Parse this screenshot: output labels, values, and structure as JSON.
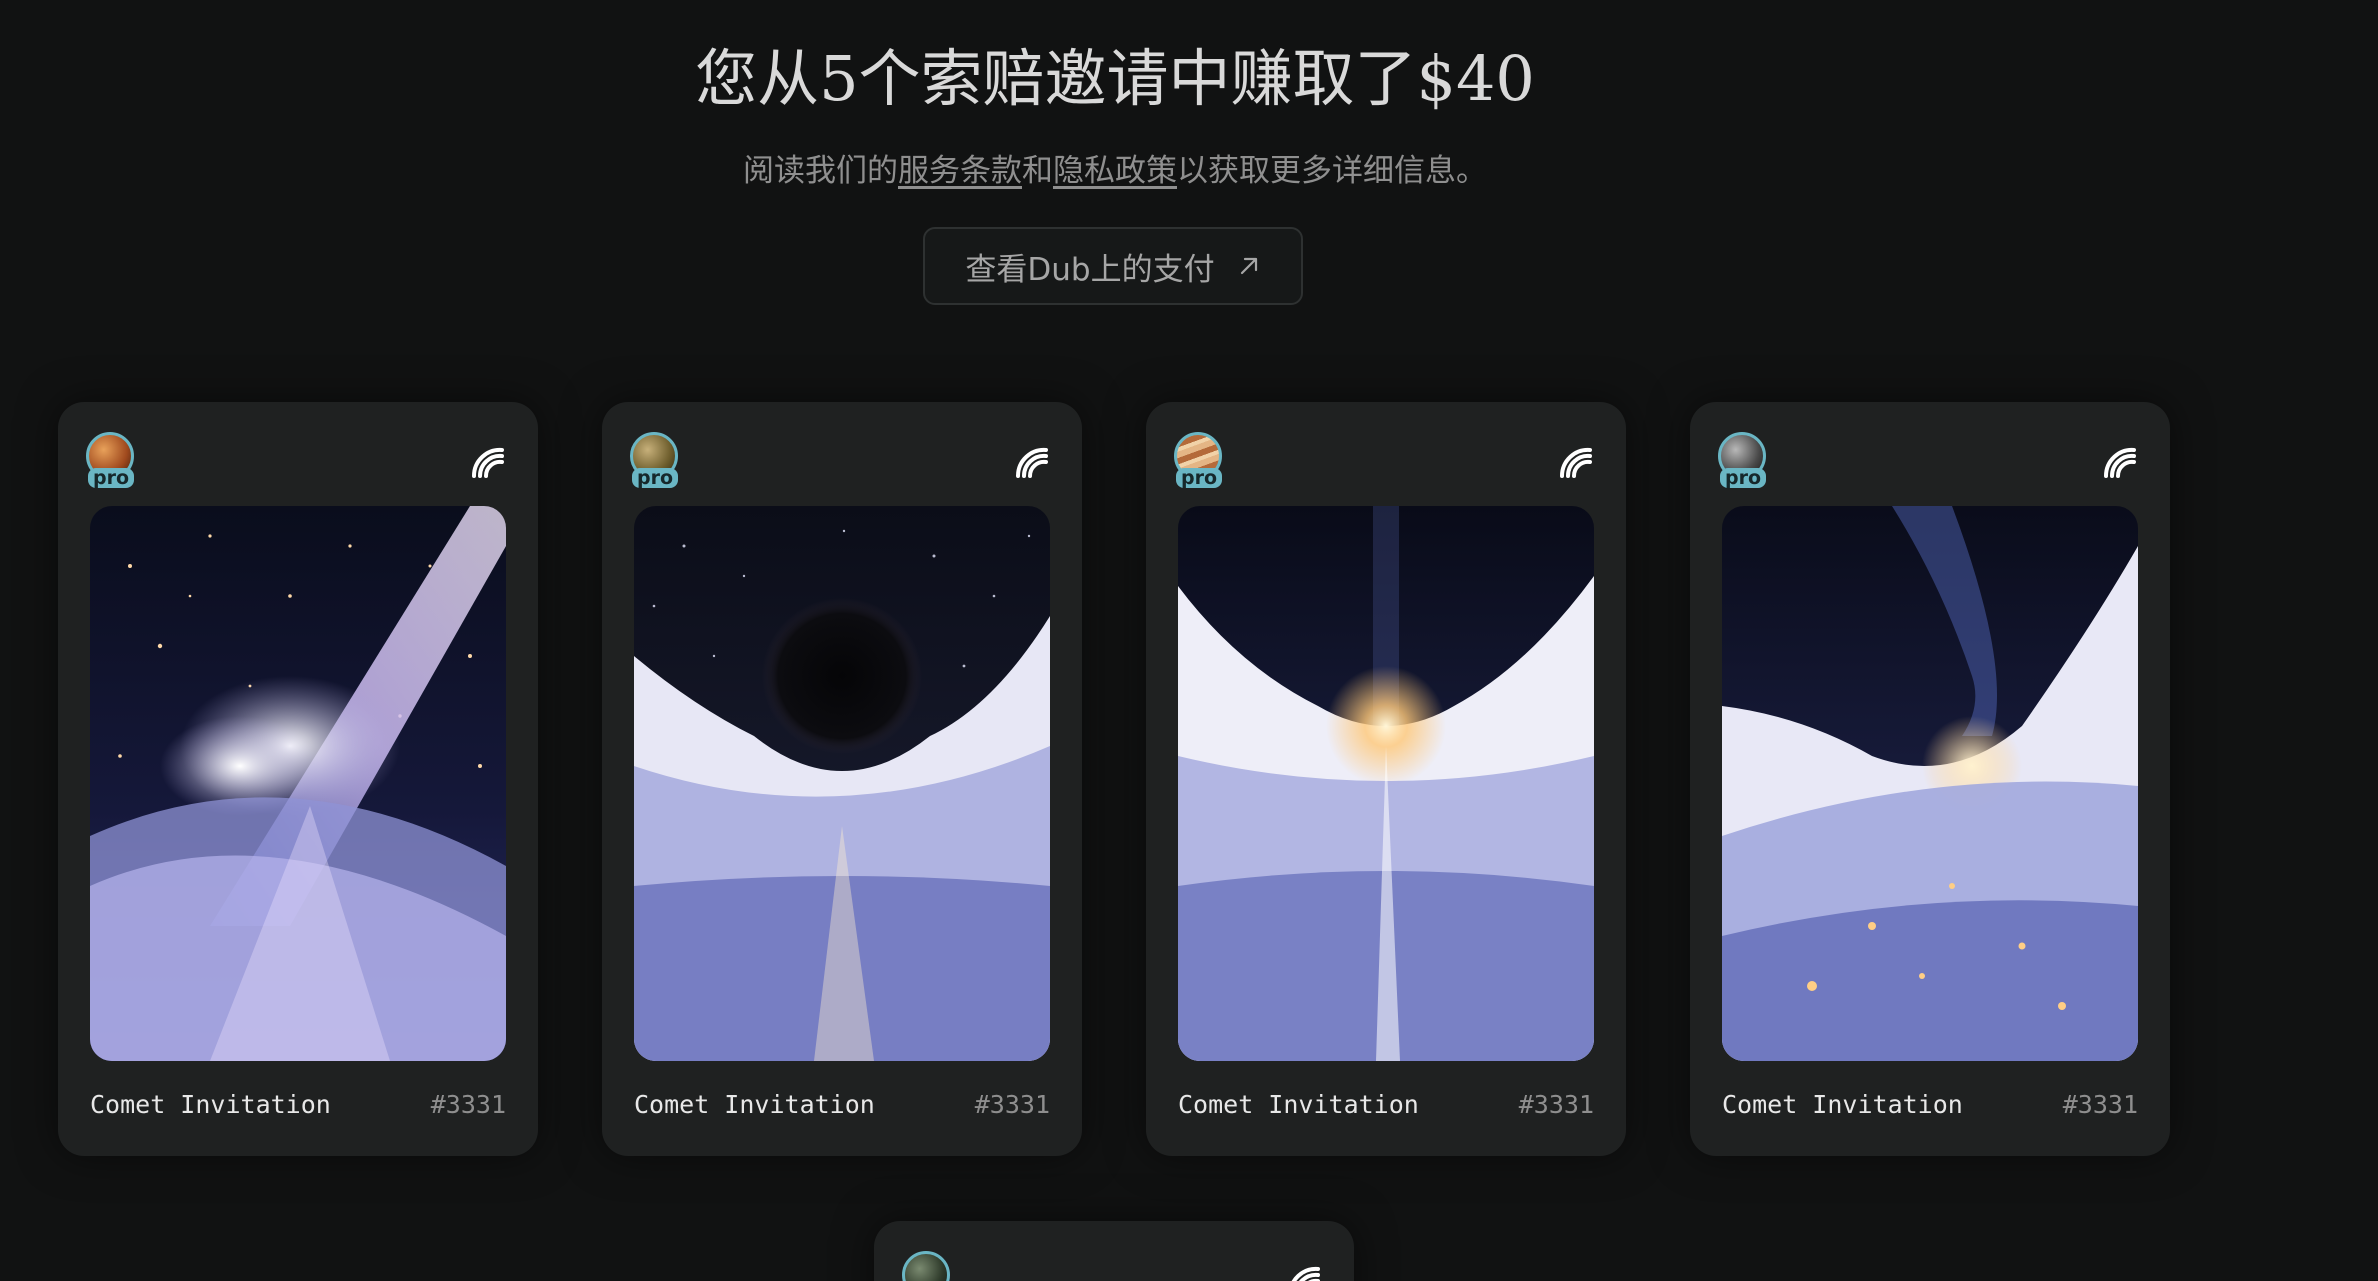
{
  "header": {
    "headline": "您从5个索赔邀请中赚取了$40",
    "sub_prefix": "阅读我们的",
    "terms_link": "服务条款",
    "sub_and": "和",
    "privacy_link": "隐私政策",
    "sub_suffix": "以获取更多详细信息。",
    "dub_button_label": "查看Dub上的支付"
  },
  "cards": [
    {
      "name": "Comet Invitation",
      "id": "#3331",
      "pro_label": "pro",
      "avatar_icon": "planet-avatar-orange",
      "brand_icon": "signal-wave-icon"
    },
    {
      "name": "Comet Invitation",
      "id": "#3331",
      "pro_label": "pro",
      "avatar_icon": "planet-avatar-olive",
      "brand_icon": "signal-wave-icon"
    },
    {
      "name": "Comet Invitation",
      "id": "#3331",
      "pro_label": "pro",
      "avatar_icon": "planet-avatar-jupiter",
      "brand_icon": "signal-wave-icon"
    },
    {
      "name": "Comet Invitation",
      "id": "#3331",
      "pro_label": "pro",
      "avatar_icon": "planet-avatar-grey",
      "brand_icon": "signal-wave-icon"
    }
  ],
  "colors": {
    "background": "#111212",
    "card": "#1f2121",
    "pro_badge": "#6ab6c4"
  }
}
